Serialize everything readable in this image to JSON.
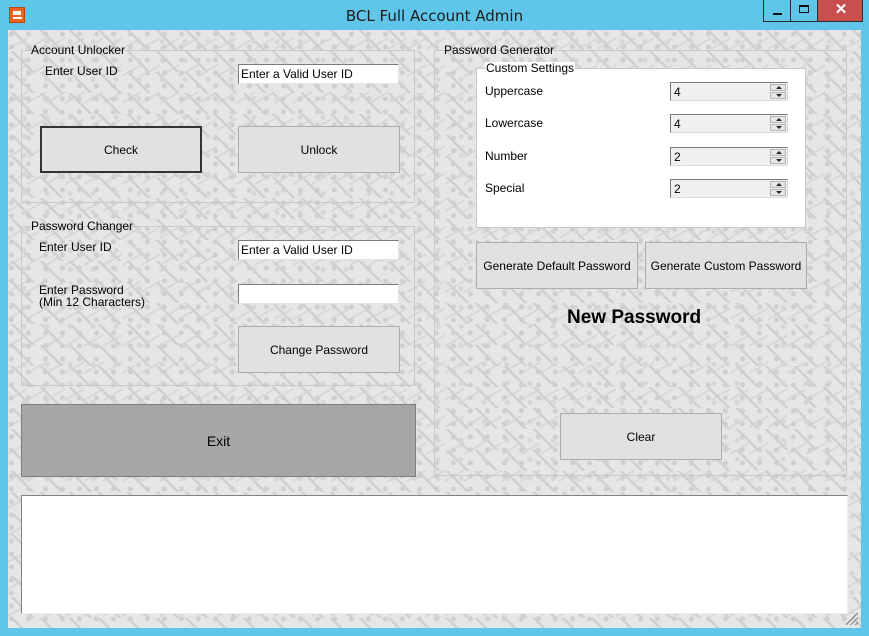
{
  "window": {
    "title": "BCL Full Account Admin",
    "close_glyph": "✕"
  },
  "account_unlocker": {
    "label": "Account Unlocker",
    "user_id_label": "Enter User ID",
    "user_id_value": "Enter a Valid User ID",
    "check_label": "Check",
    "unlock_label": "Unlock"
  },
  "password_changer": {
    "label": "Password Changer",
    "user_id_label": "Enter User ID",
    "user_id_value": "Enter a Valid User ID",
    "password_label_line1": "Enter Password",
    "password_label_line2": "(Min 12 Characters)",
    "password_value": "",
    "change_label": "Change Password"
  },
  "exit_label": "Exit",
  "password_generator": {
    "label": "Password Generator",
    "custom_settings": {
      "label": "Custom Settings",
      "fields": [
        {
          "label": "Uppercase",
          "value": "4"
        },
        {
          "label": "Lowercase",
          "value": "4"
        },
        {
          "label": "Number",
          "value": "2"
        },
        {
          "label": "Special",
          "value": "2"
        }
      ]
    },
    "generate_default_label": "Generate Default Password",
    "generate_custom_label": "Generate Custom Password",
    "new_password_text": "New Password",
    "clear_label": "Clear"
  },
  "output_text": "",
  "colors": {
    "titlebar": "#5fc6ea",
    "close_button": "#c7504f",
    "exit_button": "#a6a6a6"
  }
}
